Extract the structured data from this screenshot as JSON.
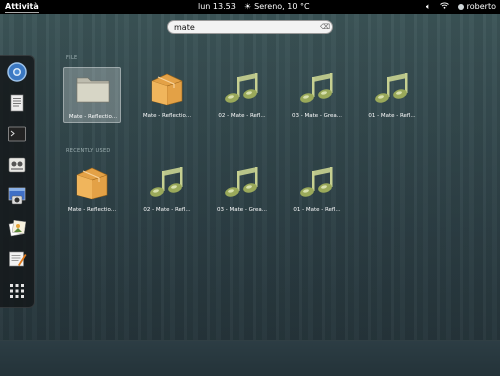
{
  "topbar": {
    "activities": "Attività",
    "clock": "lun 13.53",
    "weather": "Sereno, 10 °C",
    "user": "roberto"
  },
  "search": {
    "value": "mate"
  },
  "dash": {
    "apps": [
      "chromium",
      "document-viewer",
      "terminal",
      "system-settings",
      "screenshot",
      "image-viewer",
      "text-editor",
      "show-applications"
    ]
  },
  "sections": {
    "files": {
      "label": "FILE",
      "items": [
        {
          "label": "Mate - Reflectio...",
          "icon": "folder-icon"
        },
        {
          "label": "Mate - Reflectio...",
          "icon": "package-icon"
        },
        {
          "label": "02 - Mate - Refl...",
          "icon": "music-note-icon"
        },
        {
          "label": "03 - Mate - Grea...",
          "icon": "music-note-icon"
        },
        {
          "label": "01 - Mate - Refl...",
          "icon": "music-note-icon"
        }
      ]
    },
    "recent": {
      "label": "RECENTLY USED",
      "items": [
        {
          "label": "Mate - Reflectio...",
          "icon": "package-icon"
        },
        {
          "label": "02 - Mate - Refl...",
          "icon": "music-note-icon"
        },
        {
          "label": "03 - Mate - Grea...",
          "icon": "music-note-icon"
        },
        {
          "label": "01 - Mate - Refl...",
          "icon": "music-note-icon"
        }
      ]
    }
  }
}
